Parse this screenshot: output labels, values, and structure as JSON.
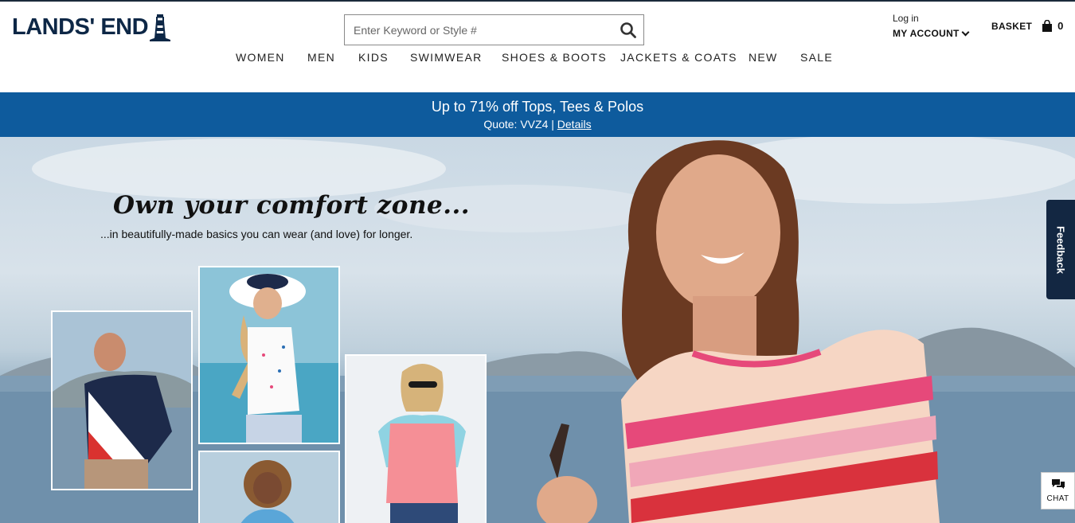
{
  "header": {
    "logo_text": "LANDS' END",
    "search": {
      "placeholder": "Enter Keyword or Style #",
      "value": ""
    },
    "account": {
      "login_label": "Log in",
      "my_account_label": "MY ACCOUNT"
    },
    "basket": {
      "label": "BASKET",
      "count": "0"
    }
  },
  "nav": {
    "items": [
      {
        "label": "WOMEN"
      },
      {
        "label": "MEN"
      },
      {
        "label": "KIDS"
      },
      {
        "label": "SWIMWEAR"
      },
      {
        "label": "SHOES & BOOTS"
      },
      {
        "label": "JACKETS & COATS"
      },
      {
        "label": "NEW"
      },
      {
        "label": "SALE"
      }
    ]
  },
  "promo": {
    "headline": "Up to 71% off Tops, Tees & Polos",
    "quote_label": "Quote: VVZ4 |",
    "details_link": "Details",
    "background_color": "#0e5b9d"
  },
  "hero": {
    "title": "Own your comfort zone...",
    "subtitle": "...in beautifully-made basics you can wear (and love) for longer."
  },
  "feedback_tab": {
    "label": "Feedback"
  },
  "chat_button": {
    "label": "CHAT"
  },
  "colors": {
    "brand_navy": "#0d2746",
    "promo_blue": "#0e5b9d",
    "feedback_bg": "#132742"
  },
  "icons": [
    "lighthouse-icon",
    "search-icon",
    "chevron-down-icon",
    "basket-icon",
    "chat-icon"
  ]
}
